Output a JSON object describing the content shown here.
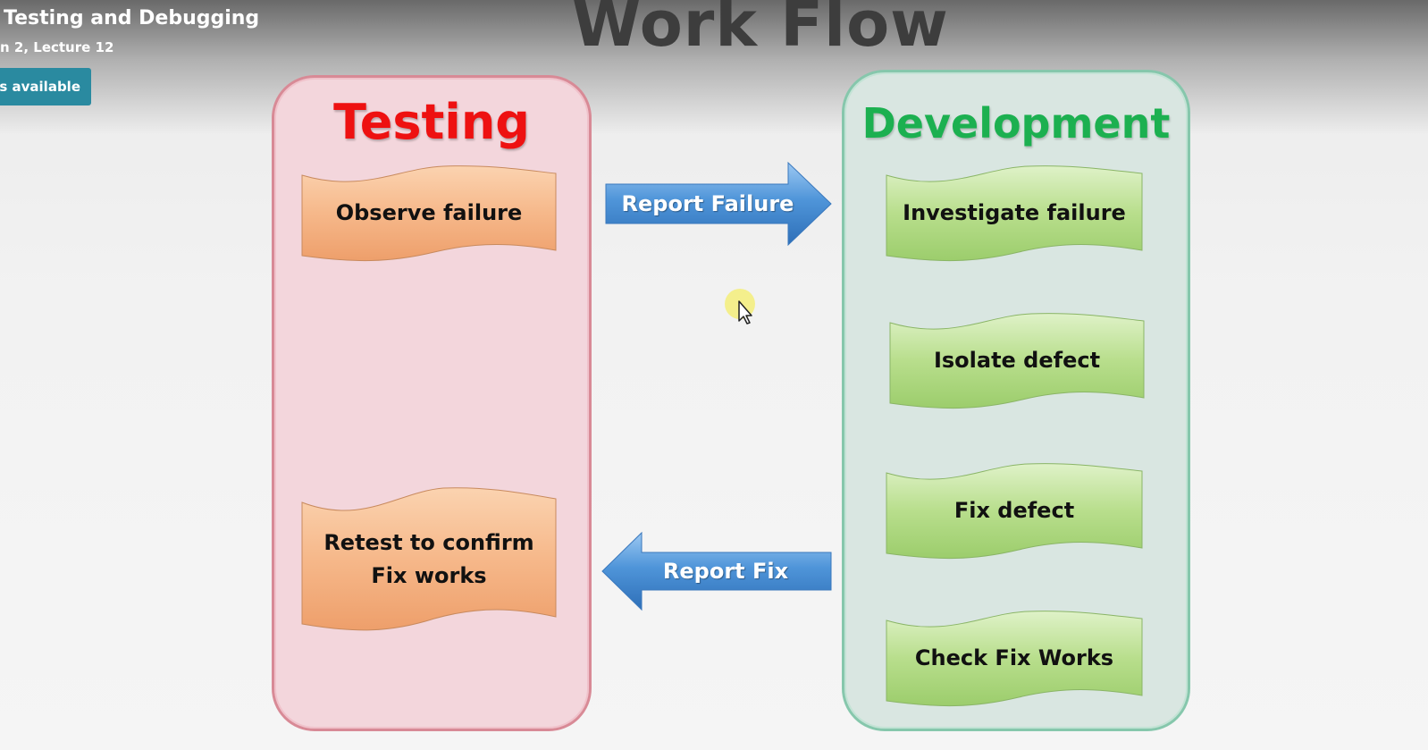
{
  "video": {
    "title": "Testing and Debugging",
    "subtitle": "n 2, Lecture 12",
    "badge_label": "es available"
  },
  "slide": {
    "title": "Work Flow",
    "testing": {
      "title": "Testing",
      "steps": [
        "Observe failure",
        "Retest to confirm\nFix works"
      ]
    },
    "development": {
      "title": "Development",
      "steps": [
        "Investigate failure",
        "Isolate defect",
        "Fix defect",
        "Check Fix Works"
      ]
    },
    "arrows": {
      "report_failure": "Report Failure",
      "report_fix": "Report Fix"
    }
  },
  "colors": {
    "testing_title": "#ee1111",
    "development_title": "#1cb050",
    "testing_flag": "#f6b88a",
    "development_flag": "#b8de8c",
    "arrow_blue": "#4f95d9",
    "badge": "#2a8aa0"
  },
  "icons": {
    "cursor": "mouse-pointer-icon"
  }
}
